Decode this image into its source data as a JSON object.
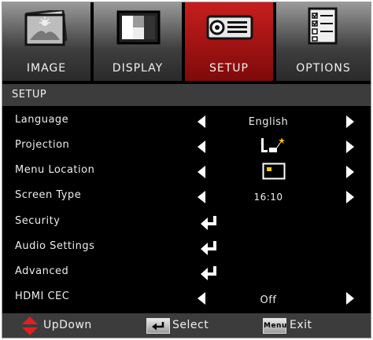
{
  "tabs": [
    {
      "label": "IMAGE",
      "icon": "image-icon",
      "active": false
    },
    {
      "label": "DISPLAY",
      "icon": "display-icon",
      "active": false
    },
    {
      "label": "SETUP",
      "icon": "projector-icon",
      "active": true
    },
    {
      "label": "OPTIONS",
      "icon": "options-icon",
      "active": false
    }
  ],
  "section_title": "SETUP",
  "rows": [
    {
      "label": "Language",
      "value": "English",
      "control": "arrows"
    },
    {
      "label": "Projection",
      "value_icon": "projection-front-desktop-icon",
      "control": "arrows"
    },
    {
      "label": "Menu Location",
      "value_icon": "menu-location-icon",
      "control": "arrows"
    },
    {
      "label": "Screen Type",
      "value": "16:10",
      "control": "arrows"
    },
    {
      "label": "Security",
      "control": "enter"
    },
    {
      "label": "Audio Settings",
      "control": "enter"
    },
    {
      "label": "Advanced",
      "control": "enter"
    },
    {
      "label": "HDMI CEC",
      "value": "Off",
      "control": "arrows"
    }
  ],
  "footer": {
    "updown_label": "UpDown",
    "select_label": "Select",
    "menu_key": "Menu",
    "exit_label": "Exit"
  },
  "colors": {
    "active_tab": "#c81e1e",
    "panel": "#000000",
    "bar": "#3c3c3c",
    "footer_arrow": "#e02020"
  }
}
